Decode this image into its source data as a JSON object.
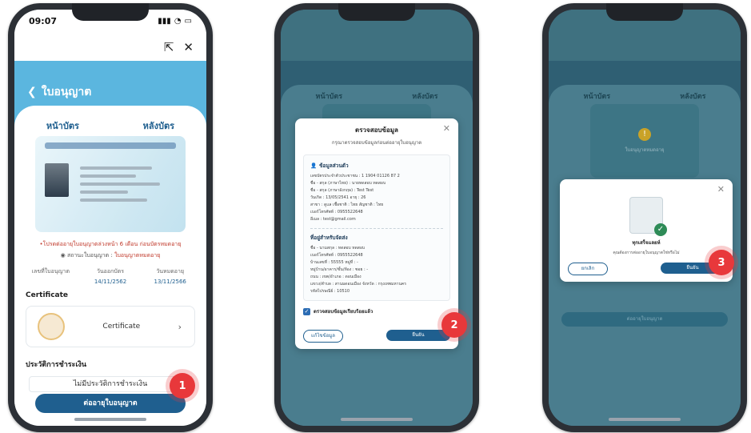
{
  "phone1": {
    "time": "09:07",
    "back_label": "ใบอนุญาต",
    "tab_front": "หน้าบัตร",
    "tab_back": "หลังบัตร",
    "warning": "•โปรดต่ออายุใบอนุญาตล่วงหน้า 6 เดือน ก่อนบัตรหมดอายุ",
    "status_label": "สถานะใบอนุญาต :",
    "status_value": "ใบอนุญาตหมดอายุ",
    "col1_label": "เลขที่ใบอนุญาต",
    "col2_label": "วันออกบัตร",
    "col2_value": "14/11/2562",
    "col3_label": "วันหมดอายุ",
    "col3_value": "13/11/2566",
    "certificate_heading": "Certificate",
    "certificate_item": "Certificate",
    "payment_heading": "ประวัติการชำระเงิน",
    "no_history": "ไม่มีประวัติการชำระเงิน",
    "renew_button": "ต่ออายุใบอนุญาต",
    "step": "1"
  },
  "phone2": {
    "tab_front": "หน้าบัตร",
    "tab_back": "หลังบัตร",
    "modal_title": "ตรวจสอบข้อมูล",
    "modal_subtitle": "กรุณาตรวจสอบข้อมูลก่อนต่ออายุใบอนุญาต",
    "section1": "ข้อมูลส่วนตัว",
    "rows1": [
      "เลขบัตรประจำตัวประชาชน : 1 1904 01126 87 2",
      "ชื่อ - สกุล (ภาษาไทย) : นายทดสอบ ทดสอบ",
      "ชื่อ - สกุล (ภาษาอังกฤษ) : Test Test",
      "วันเกิด : 13/05/2541 อายุ : 26",
      "สาขา : ดูแล เชื้อชาติ : ไทย สัญชาติ : ไทย",
      "เบอร์โทรศัพท์ : 0955522648",
      "อีเมล : test@gmail.com"
    ],
    "section2": "ที่อยู่สำหรับจัดส่ง",
    "rows2": [
      "ชื่อ - นามสกุล : ทดสอบ ทดสอบ",
      "เบอร์โทรศัพท์ : 0955522648",
      "บ้านเลขที่ : 55555 หมู่ที่ : -",
      "หมู่บ้าน/อาคาร/ชั้น/ห้อง : ซอย : -",
      "ถนน : เขต/อำเภอ : ดอนเมือง",
      "แขวง/ตำบล : สานมดอนเมือง จังหวัด : กรุงเทพมหานคร",
      "รหัสไปรษณีย์ : 10510"
    ],
    "checkbox_label": "ตรวจสอบข้อมูลเรียบร้อยแล้ว",
    "btn_edit": "แก้ไขข้อมูล",
    "btn_confirm": "ยืนยัน",
    "step": "2"
  },
  "phone3": {
    "tab_front": "หน้าบัตร",
    "tab_back": "หลังบัตร",
    "card_status": "ใบอนุญาตหมดอายุ",
    "success_title": "ทุกเสร็จแลยห์",
    "success_sub": "คุณต้องการต่ออายุใบอนุญาตใช่หรือไม่",
    "btn_cancel": "ยกเลิก",
    "btn_confirm": "ยืนยัน",
    "bottom_bar": "ต่ออายุใบอนุญาต",
    "step": "3"
  },
  "colors": {
    "primary": "#1f5f8f",
    "header": "#5bb6df",
    "step_badge": "#e8383b",
    "warning": "#c0392b"
  }
}
